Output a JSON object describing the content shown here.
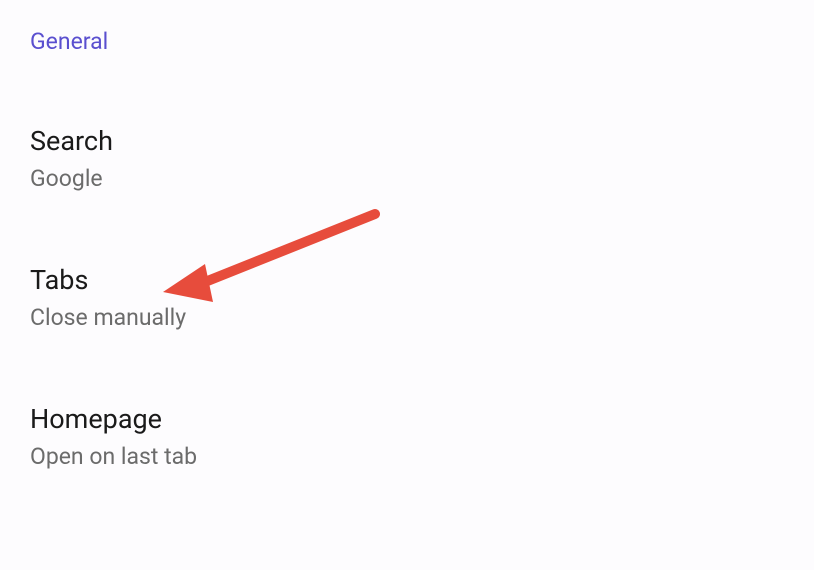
{
  "section": {
    "header": "General"
  },
  "settings": {
    "search": {
      "title": "Search",
      "value": "Google"
    },
    "tabs": {
      "title": "Tabs",
      "value": "Close manually"
    },
    "homepage": {
      "title": "Homepage",
      "value": "Open on last tab"
    }
  }
}
